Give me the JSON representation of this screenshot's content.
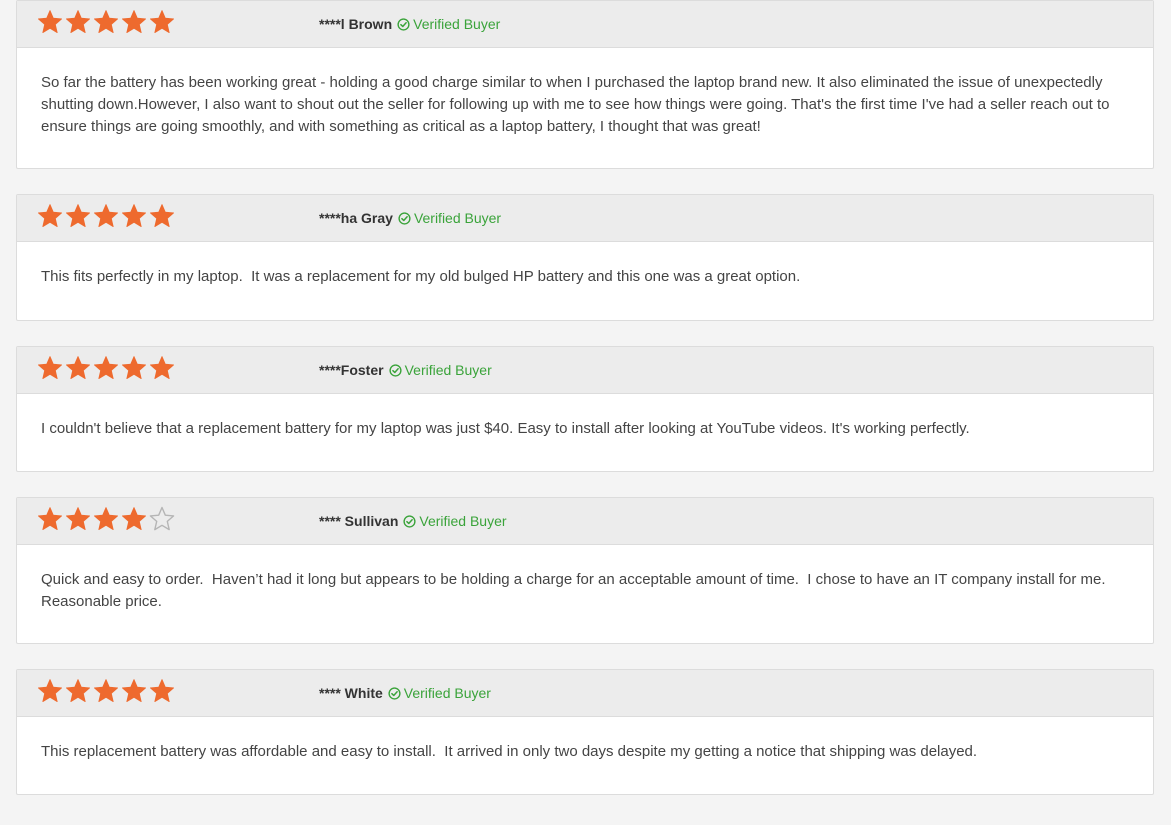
{
  "colors": {
    "star_filled": "#ee6a2e",
    "star_empty": "#b5b5b5",
    "verified_green": "#3aa33a",
    "header_bg": "#ececec",
    "border": "#dcdcdc"
  },
  "verified_label": "Verified Buyer",
  "reviews": [
    {
      "rating": 5,
      "max_rating": 5,
      "reviewer": "****l Brown",
      "verified": "Verified Buyer",
      "text": "So far the battery has been working great - holding a good charge similar to when I purchased the laptop brand new. It also eliminated the issue of unexpectedly shutting down.However, I also want to shout out the seller for following up with me to see how things were going. That's the first time I've had a seller reach out to ensure things are going smoothly, and with something as critical as a laptop battery, I thought that was great!"
    },
    {
      "rating": 5,
      "max_rating": 5,
      "reviewer": "****ha Gray",
      "verified": "Verified Buyer",
      "text": "This fits perfectly in my laptop.  It was a replacement for my old bulged HP battery and this one was a great option."
    },
    {
      "rating": 5,
      "max_rating": 5,
      "reviewer": "****Foster",
      "verified": "Verified Buyer",
      "text": "I couldn't believe that a replacement battery for my laptop was just $40. Easy to install after looking at YouTube videos. It's working perfectly."
    },
    {
      "rating": 4,
      "max_rating": 5,
      "reviewer": "**** Sullivan",
      "verified": "Verified Buyer",
      "text": "Quick and easy to order.  Haven’t had it long but appears to be holding a charge for an acceptable amount of time.  I chose to have an IT company install for me.  Reasonable price."
    },
    {
      "rating": 5,
      "max_rating": 5,
      "reviewer": "**** White",
      "verified": "Verified Buyer",
      "text": "This replacement battery was affordable and easy to install.  It arrived in only two days despite my getting a notice that shipping was delayed."
    }
  ]
}
